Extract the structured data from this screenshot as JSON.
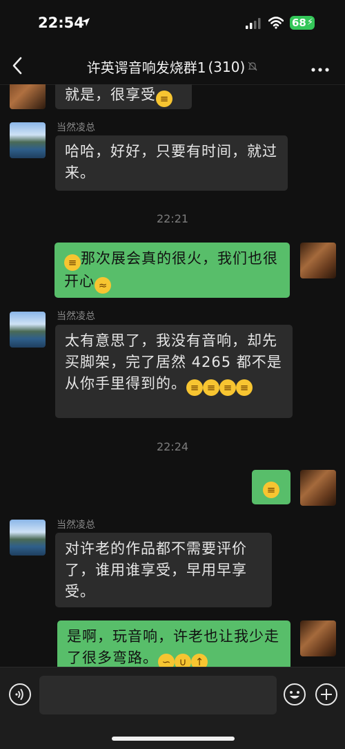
{
  "status_bar": {
    "time": "22:54",
    "battery": "68"
  },
  "header": {
    "title": "许英谔音响发烧群1",
    "member_count": "(310)"
  },
  "messages": [
    {
      "side": "in",
      "text": "就是，很享受",
      "emoji": "😁"
    },
    {
      "side": "in",
      "sender": "当然凌总",
      "text": "哈哈，好好，只要有时间，就过来。"
    },
    {
      "timestamp": "22:21"
    },
    {
      "side": "out",
      "emoji": "😁",
      "text": "那次展会真的很火，我们也很开心",
      "emoji_end": "😂"
    },
    {
      "side": "in",
      "sender": "当然凌总",
      "text": "太有意思了，我没有音响，却先买脚架，完了居然 4265 都不是从你手里得到的。",
      "emoji": "😁😁😁😁"
    },
    {
      "timestamp": "22:24"
    },
    {
      "side": "out",
      "emoji": "😁"
    },
    {
      "side": "in",
      "sender": "当然凌总",
      "text": "对许老的作品都不需要评价了，谁用谁享受，早用早享受。"
    },
    {
      "side": "out",
      "text": "是啊，玩音响，许老也让我少走了很多弯路。",
      "emoji": "👌🤭👍"
    }
  ],
  "icons": {
    "location": "location-arrow-icon",
    "signal": "signal-icon",
    "wifi": "wifi-icon",
    "back": "back-chevron-icon",
    "mute": "mute-bell-icon",
    "more": "more-dots-icon",
    "voice": "voice-icon",
    "emoji": "emoji-icon",
    "plus": "plus-icon"
  },
  "colors": {
    "outgoing_bubble": "#58be6a",
    "incoming_bubble": "#2c2c2c",
    "background": "#111111"
  }
}
